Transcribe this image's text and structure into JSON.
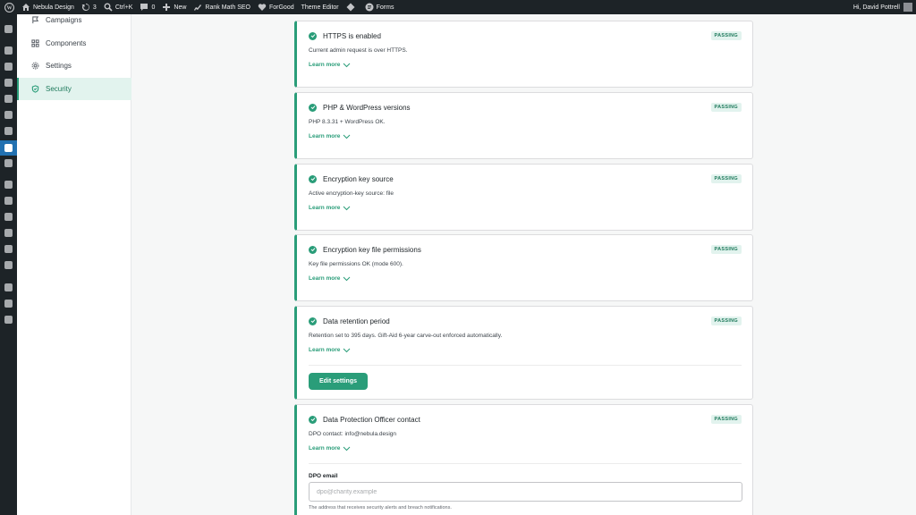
{
  "adminbar": {
    "site_name": "Nebula Design",
    "updates_count": "3",
    "shortcut": "Ctrl+K",
    "comments_count": "0",
    "new_label": "New",
    "rank_math": "Rank Math SEO",
    "forgood": "ForGood",
    "theme_editor": "Theme Editor",
    "forms": "Forms",
    "greeting": "Hi, David Pottrell"
  },
  "plugin_nav": {
    "items": [
      {
        "label": "Campaigns",
        "icon": "flag-icon"
      },
      {
        "label": "Components",
        "icon": "grid-icon"
      },
      {
        "label": "Settings",
        "icon": "gear-icon"
      },
      {
        "label": "Security",
        "icon": "shield-icon",
        "active": true
      }
    ]
  },
  "checks": [
    {
      "title": "HTTPS is enabled",
      "status": "PASSING",
      "description": "Current admin request is over HTTPS.",
      "learn_more": "Learn more"
    },
    {
      "title": "PHP & WordPress versions",
      "status": "PASSING",
      "description": "PHP 8.3.31 + WordPress OK.",
      "learn_more": "Learn more"
    },
    {
      "title": "Encryption key source",
      "status": "PASSING",
      "description": "Active encryption-key source: file",
      "learn_more": "Learn more"
    },
    {
      "title": "Encryption key file permissions",
      "status": "PASSING",
      "description": "Key file permissions OK (mode 600).",
      "learn_more": "Learn more"
    },
    {
      "title": "Data retention period",
      "status": "PASSING",
      "description": "Retention set to 395 days. Gift-Aid 6-year carve-out enforced automatically.",
      "learn_more": "Learn more",
      "action": "Edit settings"
    },
    {
      "title": "Data Protection Officer contact",
      "status": "PASSING",
      "description": "DPO contact: info@nebula.design",
      "learn_more": "Learn more",
      "field": {
        "label": "DPO email",
        "placeholder": "dpo@charity.example",
        "value": "",
        "help": "The address that receives security alerts and breach notifications."
      }
    }
  ],
  "colors": {
    "accent": "#2a9d79",
    "badge_bg": "#e2f3ee",
    "adminbar": "#1d2327",
    "menu_active": "#2271b1"
  }
}
